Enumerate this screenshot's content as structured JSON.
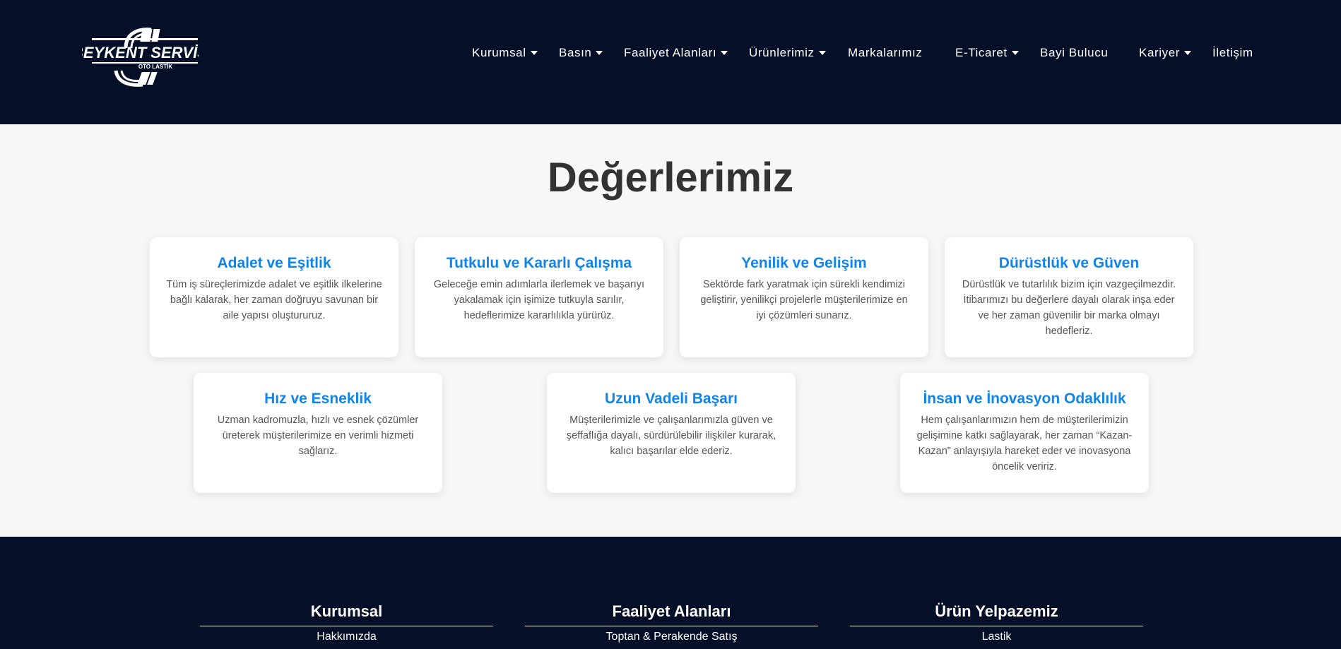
{
  "header": {
    "logo": {
      "brand": "BEYKENT SERVİS",
      "sub": "OTO LASTİK"
    },
    "nav": [
      {
        "label": "Kurumsal",
        "dropdown": true
      },
      {
        "label": "Basın",
        "dropdown": true
      },
      {
        "label": "Faaliyet Alanları",
        "dropdown": true
      },
      {
        "label": "Ürünlerimiz",
        "dropdown": true
      },
      {
        "label": "Markalarımız",
        "dropdown": false
      },
      {
        "label": "E-Ticaret",
        "dropdown": true
      },
      {
        "label": "Bayi Bulucu",
        "dropdown": false
      },
      {
        "label": "Kariyer",
        "dropdown": true
      },
      {
        "label": "İletişim",
        "dropdown": false
      }
    ]
  },
  "values": {
    "title": "Değerlerimiz",
    "cards": [
      {
        "title": "Adalet ve Eşitlik",
        "text": "Tüm iş süreçlerimizde adalet ve eşitlik ilkelerine bağlı kalarak, her zaman doğruyu savunan bir aile yapısı oluştururuz."
      },
      {
        "title": "Tutkulu ve Kararlı Çalışma",
        "text": "Geleceğe emin adımlarla ilerlemek ve başarıyı yakalamak için işimize tutkuyla sarılır, hedeflerimize kararlılıkla yürürüz."
      },
      {
        "title": "Yenilik ve Gelişim",
        "text": "Sektörde fark yaratmak için sürekli kendimizi geliştirir, yenilikçi projelerle müşterilerimize en iyi çözümleri sunarız."
      },
      {
        "title": "Dürüstlük ve Güven",
        "text": "Dürüstlük ve tutarlılık bizim için vazgeçilmezdir. İtibarımızı bu değerlere dayalı olarak inşa eder ve her zaman güvenilir bir marka olmayı hedefleriz."
      },
      {
        "title": "Hız ve Esneklik",
        "text": "Uzman kadromuzla, hızlı ve esnek çözümler üreterek müşterilerimize en verimli hizmeti sağlarız."
      },
      {
        "title": "Uzun Vadeli Başarı",
        "text": "Müşterilerimizle ve çalışanlarımızla güven ve şeffaflığa dayalı, sürdürülebilir ilişkiler kurarak, kalıcı başarılar elde ederiz."
      },
      {
        "title": "İnsan ve İnovasyon Odaklılık",
        "text": "Hem çalışanlarımızın hem de müşterilerimizin gelişimine katkı sağlayarak, her zaman “Kazan-Kazan” anlayışıyla hareket eder ve inovasyona öncelik veririz."
      }
    ]
  },
  "footer": {
    "columns": [
      {
        "title": "Kurumsal",
        "links": [
          "Hakkımızda"
        ]
      },
      {
        "title": "Faaliyet Alanları",
        "links": [
          "Toptan & Perakende Satış"
        ]
      },
      {
        "title": "Ürün Yelpazemiz",
        "links": [
          "Lastik"
        ]
      }
    ]
  },
  "colors": {
    "navy": "#060f28",
    "accent": "#1184e8",
    "bg": "#f7f7f7"
  }
}
